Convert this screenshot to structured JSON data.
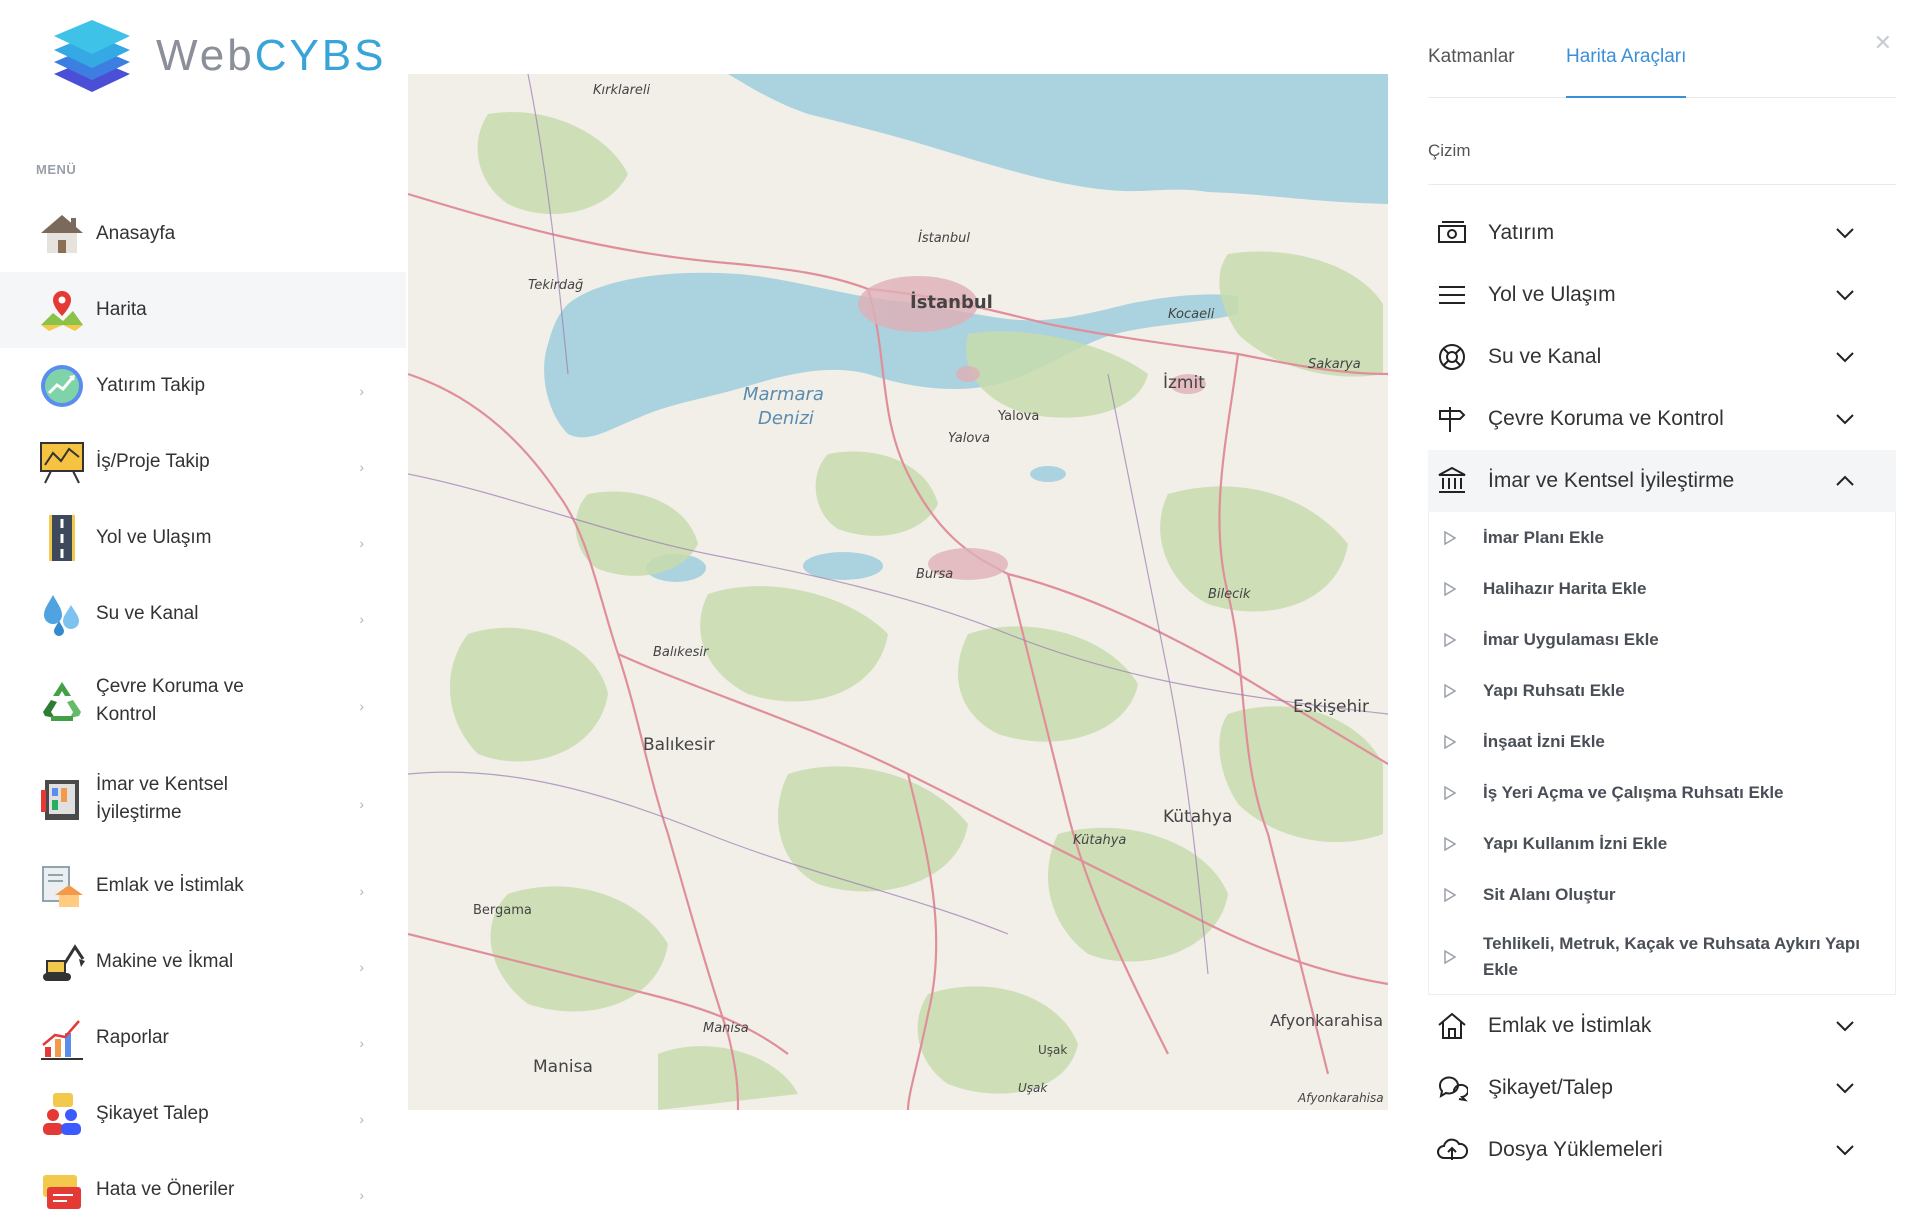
{
  "app": {
    "logo_text_1": "Web",
    "logo_text_2": "CYBS"
  },
  "sidebar": {
    "menu_title": "MENÜ",
    "items": [
      {
        "label": "Anasayfa",
        "icon": "home-icon",
        "has_chevron": false
      },
      {
        "label": "Harita",
        "icon": "map-pin-icon",
        "has_chevron": false,
        "active": true
      },
      {
        "label": "Yatırım Takip",
        "icon": "investment-chart-icon",
        "has_chevron": true
      },
      {
        "label": "İş/Proje Takip",
        "icon": "project-board-icon",
        "has_chevron": true
      },
      {
        "label": "Yol ve Ulaşım",
        "icon": "road-icon",
        "has_chevron": true
      },
      {
        "label": "Su ve Kanal",
        "icon": "water-drops-icon",
        "has_chevron": true
      },
      {
        "label": "Çevre Koruma ve Kontrol",
        "icon": "recycle-icon",
        "has_chevron": true
      },
      {
        "label": "İmar ve Kentsel İyileştirme",
        "icon": "city-plan-icon",
        "has_chevron": true
      },
      {
        "label": "Emlak ve İstimlak",
        "icon": "real-estate-icon",
        "has_chevron": true
      },
      {
        "label": "Makine ve İkmal",
        "icon": "excavator-icon",
        "has_chevron": true
      },
      {
        "label": "Raporlar",
        "icon": "report-chart-icon",
        "has_chevron": true
      },
      {
        "label": "Şikayet Talep",
        "icon": "complaint-users-icon",
        "has_chevron": true
      },
      {
        "label": "Hata ve Öneriler",
        "icon": "feedback-icon",
        "has_chevron": true
      }
    ]
  },
  "map": {
    "places": {
      "kirklareli": "Kırklareli",
      "tekirdag": "Tekirdağ",
      "istanbul_small": "İstanbul",
      "istanbul": "İstanbul",
      "kocaeli": "Kocaeli",
      "sakarya": "Sakarya",
      "izmit": "İzmit",
      "marmara1": "Marmara",
      "marmara2": "Denizi",
      "yalova": "Yalova",
      "yalova2": "Yalova",
      "bursa": "Bursa",
      "bilecik": "Bilecik",
      "balikesir_small": "Balıkesir",
      "balikesir": "Balıkesir",
      "eskisehir": "Eskişehir",
      "kutahya": "Kütahya",
      "kutahya_small": "Kütahya",
      "bergama": "Bergama",
      "manisa_small": "Manisa",
      "manisa": "Manisa",
      "afyon": "Afyonkarahisa",
      "afyon_small": "Afyonkarahisa",
      "usak": "Uşak",
      "usak_small": "Uşak"
    },
    "colors": {
      "land": "#f2efe9",
      "forest": "#c8dcae",
      "water": "#aad3df",
      "road": "#e08f9a"
    }
  },
  "panel": {
    "tabs": [
      "Katmanlar",
      "Harita Araçları"
    ],
    "active_tab": 1,
    "section_title": "Çizim",
    "accordion": [
      {
        "label": "Yatırım",
        "icon": "money-icon",
        "open": false
      },
      {
        "label": "Yol ve Ulaşım",
        "icon": "menu-lines-icon",
        "open": false
      },
      {
        "label": "Su ve Kanal",
        "icon": "lifebuoy-icon",
        "open": false
      },
      {
        "label": "Çevre Koruma ve Kontrol",
        "icon": "signpost-icon",
        "open": false
      },
      {
        "label": "İmar ve Kentsel İyileştirme",
        "icon": "bank-icon",
        "open": true,
        "sub_items": [
          "İmar Planı Ekle",
          "Halihazır Harita Ekle",
          "İmar Uygulaması Ekle",
          "Yapı Ruhsatı Ekle",
          "İnşaat İzni Ekle",
          "İş Yeri Açma ve Çalışma Ruhsatı Ekle",
          "Yapı Kullanım İzni Ekle",
          "Sit Alanı Oluştur",
          "Tehlikeli, Metruk, Kaçak ve Ruhsata Aykırı Yapı Ekle"
        ]
      },
      {
        "label": "Emlak ve İstimlak",
        "icon": "house-outline-icon",
        "open": false
      },
      {
        "label": "Şikayet/Talep",
        "icon": "chat-bubbles-icon",
        "open": false
      },
      {
        "label": "Dosya Yüklemeleri",
        "icon": "cloud-upload-icon",
        "open": false
      }
    ]
  }
}
